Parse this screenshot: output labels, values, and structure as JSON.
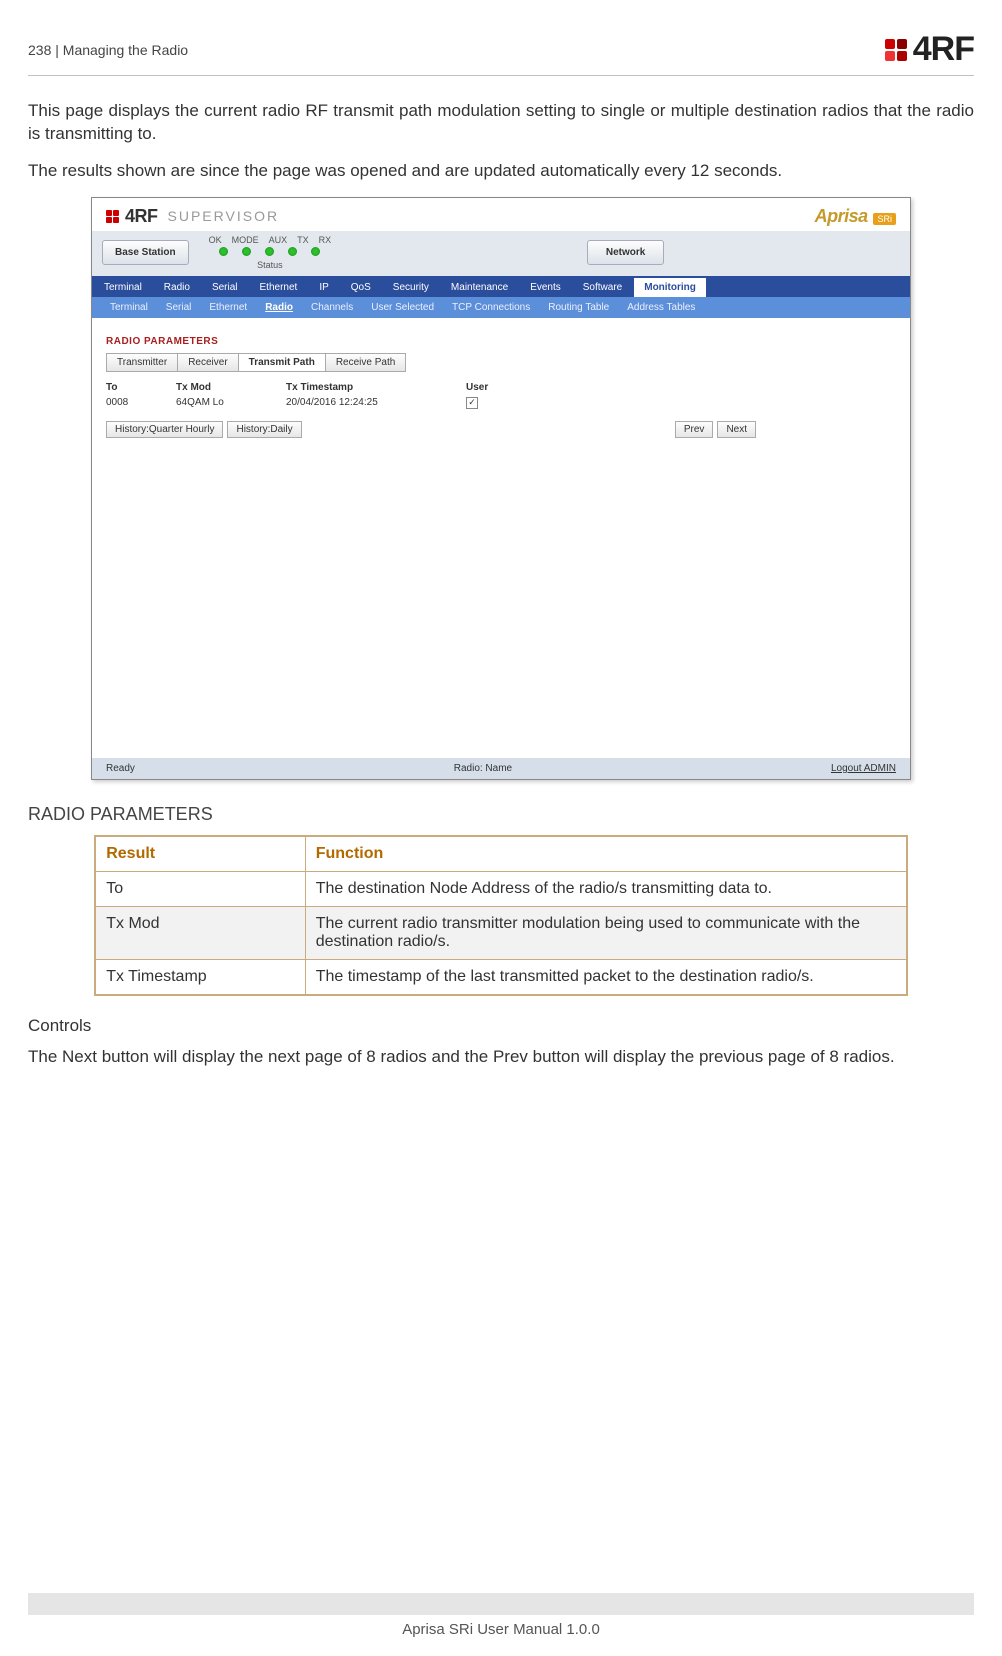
{
  "header": {
    "page_number": "238",
    "section": "Managing the Radio",
    "brand": "4RF"
  },
  "intro": {
    "p1": "This page displays the current radio RF transmit path modulation setting to single or multiple destination radios that the radio is transmitting to.",
    "p2": "The results shown are since the page was opened and are updated automatically every 12 seconds."
  },
  "app": {
    "brand_word": "4RF",
    "brand_sub": "SUPERVISOR",
    "aprisa": "Aprisa",
    "aprisa_badge": "SRi",
    "station": "Base Station",
    "led_labels": [
      "OK",
      "MODE",
      "AUX",
      "TX",
      "RX"
    ],
    "status_label": "Status",
    "network": "Network",
    "tabs1": [
      "Terminal",
      "Radio",
      "Serial",
      "Ethernet",
      "IP",
      "QoS",
      "Security",
      "Maintenance",
      "Events",
      "Software",
      "Monitoring"
    ],
    "tabs1_active": "Monitoring",
    "tabs2": [
      "Terminal",
      "Serial",
      "Ethernet",
      "Radio",
      "Channels",
      "User Selected",
      "TCP Connections",
      "Routing Table",
      "Address Tables"
    ],
    "tabs2_active": "Radio",
    "panel_title": "RADIO PARAMETERS",
    "subtabs": [
      "Transmitter",
      "Receiver",
      "Transmit Path",
      "Receive Path"
    ],
    "subtabs_active": "Transmit Path",
    "cols": {
      "to": "To",
      "txmod": "Tx Mod",
      "ts": "Tx Timestamp",
      "user": "User"
    },
    "row": {
      "to": "0008",
      "txmod": "64QAM Lo",
      "ts": "20/04/2016 12:24:25",
      "user_checked": "✓"
    },
    "history": {
      "qh": "History:Quarter Hourly",
      "daily": "History:Daily",
      "prev": "Prev",
      "next": "Next"
    },
    "footer": {
      "ready": "Ready",
      "name": "Radio: Name",
      "logout": "Logout ADMIN"
    }
  },
  "section_heading": "RADIO PARAMETERS",
  "table": {
    "head": {
      "result": "Result",
      "function": "Function"
    },
    "rows": [
      {
        "result": "To",
        "func": "The destination Node Address of the radio/s transmitting data to."
      },
      {
        "result": "Tx Mod",
        "func": "The current radio transmitter modulation being used to communicate with the destination radio/s."
      },
      {
        "result": "Tx Timestamp",
        "func": "The timestamp of the last transmitted packet to the destination radio/s."
      }
    ]
  },
  "controls": {
    "heading": "Controls",
    "text": "The Next button will display the next page of 8 radios and the Prev button will display the previous page of 8 radios."
  },
  "footer": {
    "manual": "Aprisa SRi User Manual 1.0.0"
  }
}
